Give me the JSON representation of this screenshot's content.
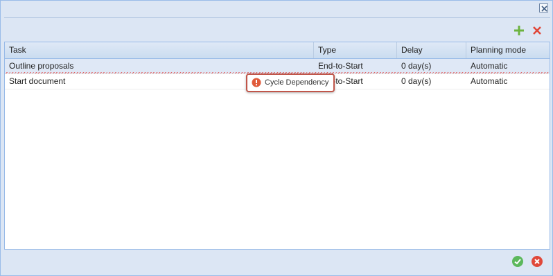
{
  "dialog": {
    "close_icon": "close-icon",
    "toolbar": {
      "add_icon": "plus-icon",
      "delete_icon": "delete-x-icon",
      "add_color": "#6cb33f",
      "delete_color": "#e0483a"
    },
    "columns": {
      "task": "Task",
      "type": "Type",
      "delay": "Delay",
      "mode": "Planning mode"
    },
    "rows": [
      {
        "task": "Outline proposals",
        "type": "End-to-Start",
        "delay": "0 day(s)",
        "mode": "Automatic"
      },
      {
        "task": "Start document",
        "type": "End-to-Start",
        "delay": "0 day(s)",
        "mode": "Automatic"
      }
    ],
    "tooltip": {
      "text": "Cycle Dependency",
      "icon": "error-icon",
      "color": "#c0564a"
    },
    "footer": {
      "ok_icon": "check-circle-icon",
      "cancel_icon": "cancel-circle-icon",
      "ok_color": "#5cb85c",
      "cancel_color": "#e0483a"
    }
  }
}
